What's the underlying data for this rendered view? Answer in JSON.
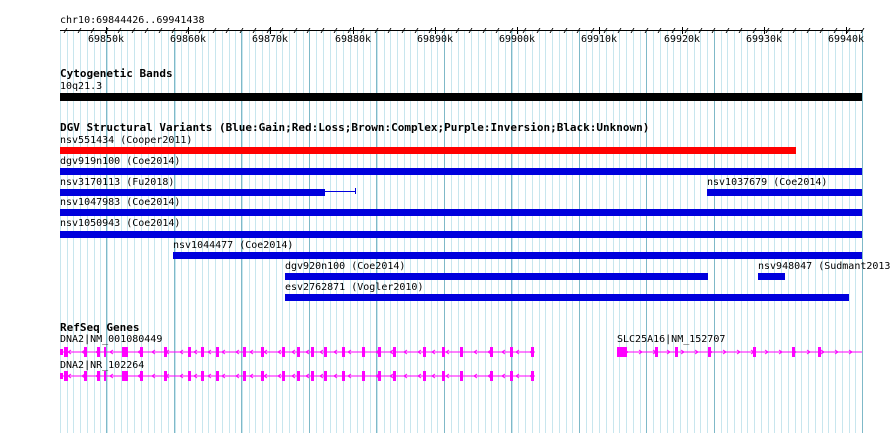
{
  "ruler": {
    "location": "chr10:69844426..69941438",
    "ticks": [
      "69850k",
      "69860k",
      "69870k",
      "69880k",
      "69890k",
      "69900k",
      "69910k",
      "69920k",
      "69930k",
      "69940k"
    ]
  },
  "tracks": {
    "cytoband": {
      "title": "Cytogenetic Bands",
      "band_label": "10q21.3",
      "color": "#000000"
    },
    "dgv": {
      "title": "DGV Structural Variants (Blue:Gain;Red:Loss;Brown:Complex;Purple:Inversion;Black:Unknown)",
      "colors": {
        "gain": "#0000dd",
        "loss": "#ff0000"
      },
      "features": [
        {
          "label": "nsv551434 (Cooper2011)",
          "type": "loss"
        },
        {
          "label": "dgv919n100 (Coe2014)",
          "type": "gain"
        },
        {
          "label": "nsv3170113 (Fu2018)",
          "type": "gain"
        },
        {
          "label": "nsv1037679 (Coe2014)",
          "type": "gain"
        },
        {
          "label": "nsv1047983 (Coe2014)",
          "type": "gain"
        },
        {
          "label": "nsv1050943 (Coe2014)",
          "type": "gain"
        },
        {
          "label": "nsv1044477 (Coe2014)",
          "type": "gain"
        },
        {
          "label": "dgv920n100 (Coe2014)",
          "type": "gain"
        },
        {
          "label": "nsv948047 (Sudmant2013",
          "type": "gain"
        },
        {
          "label": "esv2762871 (Vogler2010)",
          "type": "gain"
        }
      ]
    },
    "refseq": {
      "title": "RefSeq Genes",
      "color": "#ff00ff",
      "genes": [
        {
          "label": "DNA2|NM_001080449"
        },
        {
          "label": "SLC25A16|NM_152707"
        },
        {
          "label": "DNA2|NR_102264"
        }
      ]
    }
  }
}
